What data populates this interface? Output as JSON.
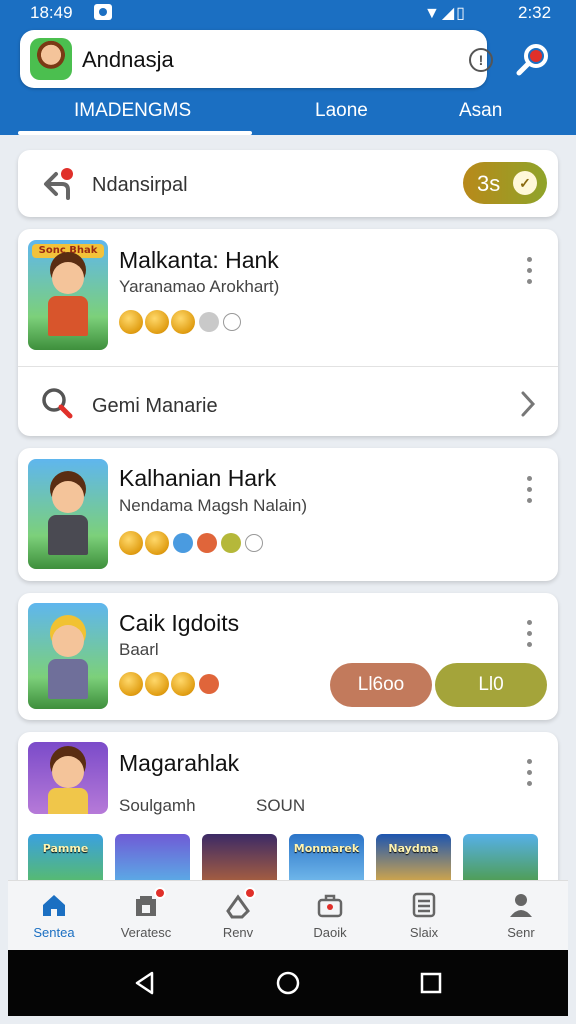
{
  "status": {
    "time": "18:49",
    "right_time": "2:32",
    "signal_icons": [
      "wifi-icon",
      "signal-icon",
      "battery-icon"
    ]
  },
  "header": {
    "title": "Andnasja",
    "tabs": [
      {
        "label": "IMADENGMS",
        "active": true
      },
      {
        "label": "Laone",
        "active": false
      },
      {
        "label": "Asan",
        "active": false
      }
    ],
    "accent": "#1b6fc2"
  },
  "ind_card": {
    "title": "Ndansirpal",
    "score": "3s"
  },
  "games": [
    {
      "title": "Malkanta: Hank",
      "subtitle": "Yaranamao Arokhart)",
      "thumb_banner": "Sonc Bhak"
    },
    {
      "title": "Kalhanian Hark",
      "subtitle": "Nendama Magsh Nalain)"
    },
    {
      "title": "Caik Igdoits",
      "subtitle": "Baarl",
      "button_a": "Ll6oo",
      "button_b": "Ll0"
    },
    {
      "title": "Magarahlak",
      "subtitle": "Soulgamh",
      "extra": "SOUN",
      "strip": [
        "Pamme",
        "",
        "",
        "Monmarek",
        "Naydma",
        ""
      ]
    }
  ],
  "manage_row": {
    "label": "Gemi Manarie"
  },
  "nav": [
    {
      "label": "Sentea",
      "icon": "home-icon",
      "active": true
    },
    {
      "label": "Veratesc",
      "icon": "store-icon",
      "active": false
    },
    {
      "label": "Renv",
      "icon": "tag-icon",
      "active": false
    },
    {
      "label": "Daoik",
      "icon": "briefcase-icon",
      "active": false
    },
    {
      "label": "Slaix",
      "icon": "list-icon",
      "active": false
    },
    {
      "label": "Senr",
      "icon": "profile-icon",
      "active": false
    }
  ]
}
